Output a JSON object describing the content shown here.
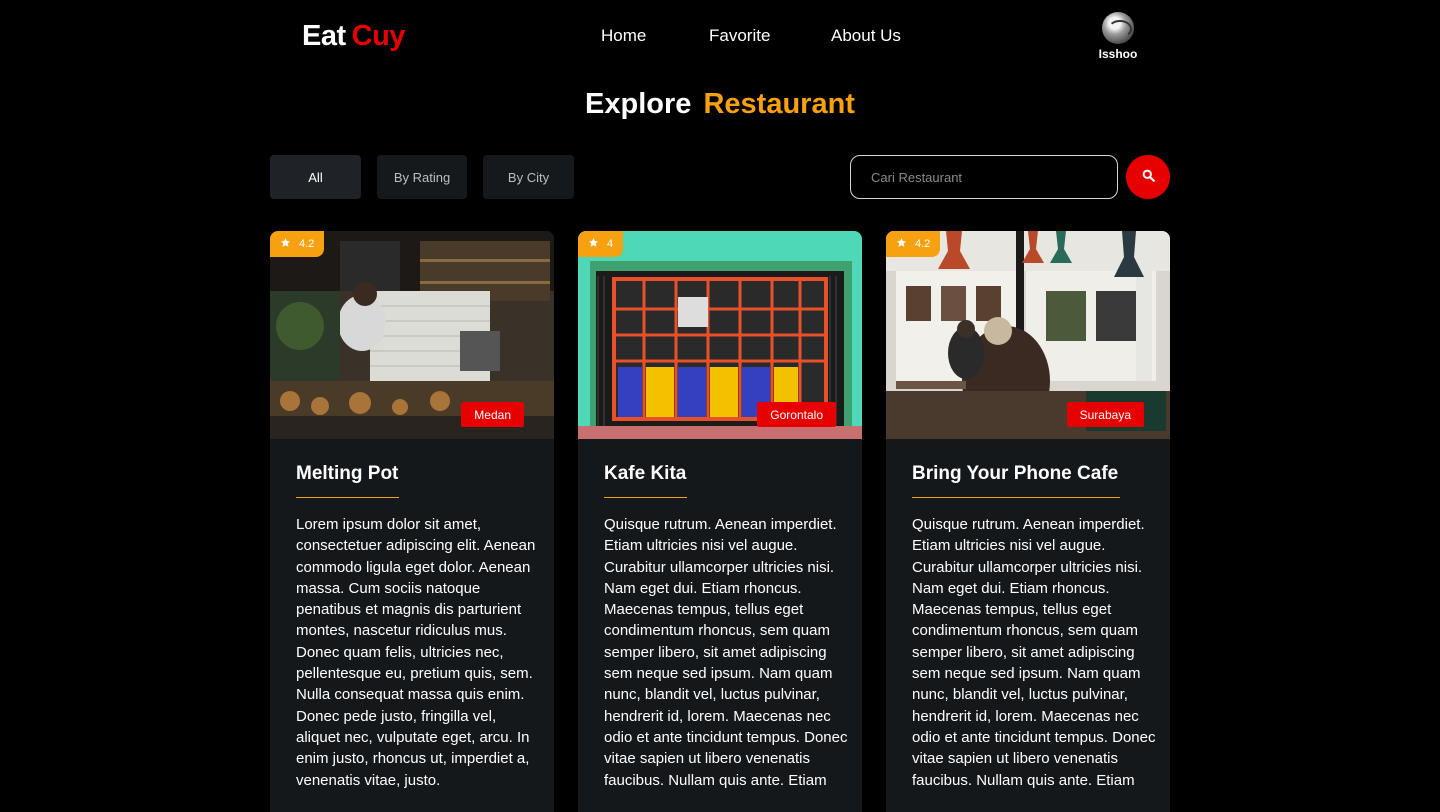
{
  "brand": {
    "part1": "Eat",
    "part2": "Cuy"
  },
  "nav": {
    "home": "Home",
    "favorite": "Favorite",
    "about": "About Us"
  },
  "profile": {
    "name": "Isshoo"
  },
  "section": {
    "title_part1": "Explore",
    "title_part2": "Restaurant"
  },
  "filters": {
    "all": "All",
    "by_rating": "By Rating",
    "by_city": "By City"
  },
  "search": {
    "placeholder": "Cari Restaurant"
  },
  "colors": {
    "accent": "#f7a010",
    "brand_red": "#e60000",
    "card_bg": "#15181b"
  },
  "restaurants": [
    {
      "rating": "4.2",
      "city": "Medan",
      "name": "Melting Pot",
      "description": "Lorem ipsum dolor sit amet, consectetuer adipiscing elit. Aenean commodo ligula eget dolor. Aenean massa. Cum sociis natoque penatibus et magnis dis parturient montes, nascetur ridiculus mus. Donec quam felis, ultricies nec, pellentesque eu, pretium quis, sem. Nulla consequat massa quis enim. Donec pede justo, fringilla vel, aliquet nec, vulputate eget, arcu. In enim justo, rhoncus ut, imperdiet a, venenatis vitae, justo."
    },
    {
      "rating": "4",
      "city": "Gorontalo",
      "name": "Kafe Kita",
      "description": "Quisque rutrum. Aenean imperdiet. Etiam ultricies nisi vel augue. Curabitur ullamcorper ultricies nisi. Nam eget dui. Etiam rhoncus. Maecenas tempus, tellus eget condimentum rhoncus, sem quam semper libero, sit amet adipiscing sem neque sed ipsum. Nam quam nunc, blandit vel, luctus pulvinar, hendrerit id, lorem. Maecenas nec odio et ante tincidunt tempus. Donec vitae sapien ut libero venenatis faucibus. Nullam quis ante. Etiam"
    },
    {
      "rating": "4.2",
      "city": "Surabaya",
      "name": "Bring Your Phone Cafe",
      "description": "Quisque rutrum. Aenean imperdiet. Etiam ultricies nisi vel augue. Curabitur ullamcorper ultricies nisi. Nam eget dui. Etiam rhoncus. Maecenas tempus, tellus eget condimentum rhoncus, sem quam semper libero, sit amet adipiscing sem neque sed ipsum. Nam quam nunc, blandit vel, luctus pulvinar, hendrerit id, lorem. Maecenas nec odio et ante tincidunt tempus. Donec vitae sapien ut libero venenatis faucibus. Nullam quis ante. Etiam"
    }
  ]
}
